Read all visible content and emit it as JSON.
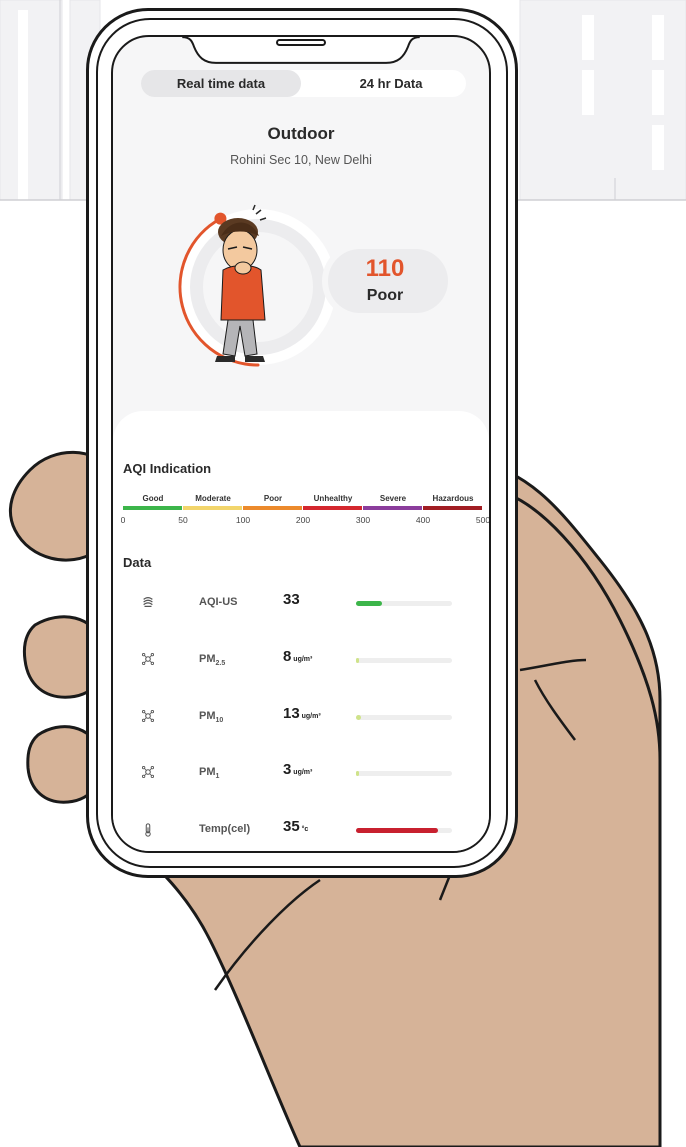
{
  "tabs": [
    {
      "label": "Real time data",
      "active": true
    },
    {
      "label": "24 hr Data",
      "active": false
    }
  ],
  "location": {
    "title": "Outdoor",
    "subtitle": "Rohini Sec 10, New Delhi"
  },
  "aqi": {
    "value": "110",
    "category": "Poor",
    "color": "#e2552c",
    "gauge_fraction": 0.22
  },
  "aqi_indication": {
    "title": "AQI Indication",
    "levels": [
      {
        "label": "Good",
        "color": "#3cb54a"
      },
      {
        "label": "Moderate",
        "color": "#f2d56b"
      },
      {
        "label": "Poor",
        "color": "#ec8a2c"
      },
      {
        "label": "Unhealthy",
        "color": "#d4272e"
      },
      {
        "label": "Severe",
        "color": "#8b3d9c"
      },
      {
        "label": "Hazardous",
        "color": "#a11d23"
      }
    ],
    "ticks": [
      "0",
      "50",
      "100",
      "200",
      "300",
      "400",
      "500"
    ]
  },
  "data_section": {
    "title": "Data",
    "rows": [
      {
        "icon": "aqi-icon",
        "name": "AQI-US",
        "sub": "",
        "value": "33",
        "unit": "",
        "fraction": 0.27,
        "color": "#3cb54a"
      },
      {
        "icon": "particle-icon",
        "name": "PM",
        "sub": "2.5",
        "value": "8",
        "unit": "ug/m³",
        "fraction": 0.03,
        "color": "#cfe38a"
      },
      {
        "icon": "particle-icon",
        "name": "PM",
        "sub": "10",
        "value": "13",
        "unit": "ug/m³",
        "fraction": 0.05,
        "color": "#cfe38a"
      },
      {
        "icon": "particle-icon",
        "name": "PM",
        "sub": "1",
        "value": "3",
        "unit": "ug/m³",
        "fraction": 0.03,
        "color": "#cfe38a"
      },
      {
        "icon": "thermometer-icon",
        "name": "Temp(cel)",
        "sub": "",
        "value": "35",
        "unit": "°c",
        "fraction": 0.85,
        "color": "#c8202f"
      }
    ]
  }
}
